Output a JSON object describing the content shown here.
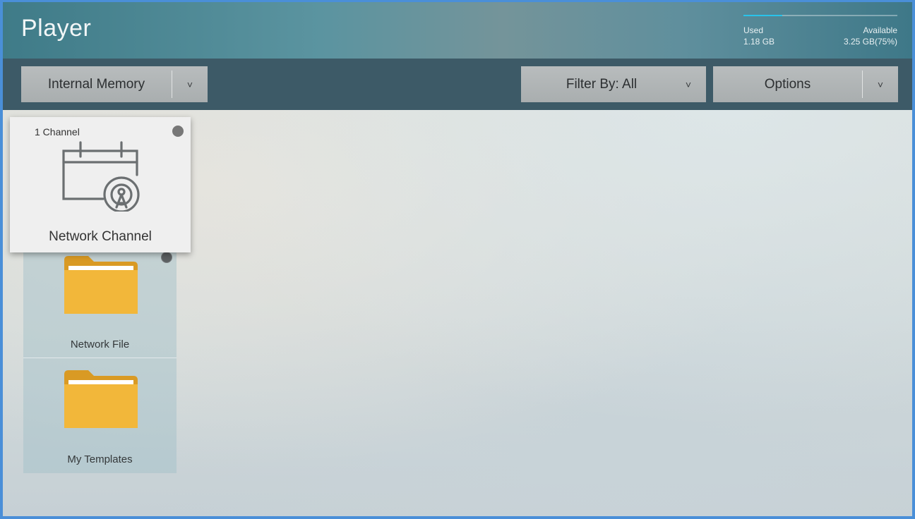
{
  "app": {
    "title": "Player"
  },
  "storage": {
    "used_label": "Used",
    "used_value": "1.18 GB",
    "available_label": "Available",
    "available_value": "3.25 GB(75%)",
    "used_fraction": 0.25,
    "bar_color": "#29c3ea"
  },
  "toolbar": {
    "source": {
      "label": "Internal Memory",
      "arrow": "˅"
    },
    "filter": {
      "label": "Filter By: All",
      "arrow": "˅"
    },
    "options": {
      "label": "Options",
      "arrow": "˅"
    }
  },
  "focused_card": {
    "count": "1 Channel",
    "name": "Network Channel",
    "icon": "network-channel-icon"
  },
  "items": [
    {
      "name": "Network File",
      "icon": "folder-icon"
    },
    {
      "name": "My Templates",
      "icon": "folder-icon"
    }
  ],
  "colors": {
    "folder": "#f2b73a",
    "folder_dark": "#d99a24",
    "accent": "#29c3ea"
  }
}
